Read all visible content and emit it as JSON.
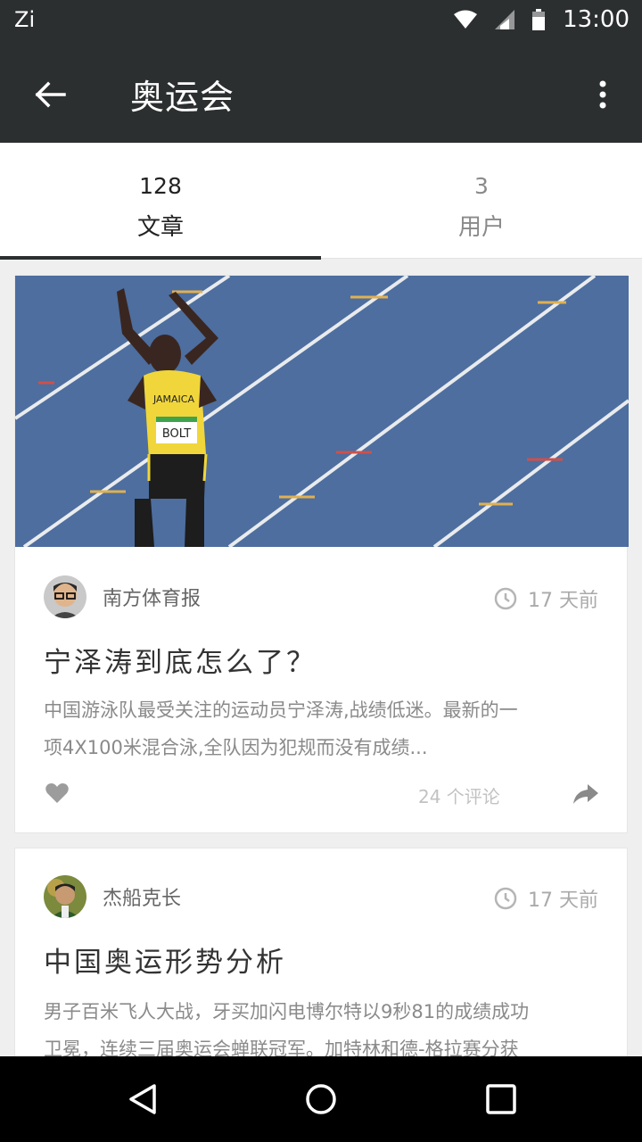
{
  "status_bar": {
    "left_text": "Zi",
    "time": "13:00"
  },
  "app_bar": {
    "title": "奥运会"
  },
  "tabs": [
    {
      "count": "128",
      "label": "文章"
    },
    {
      "count": "3",
      "label": "用户"
    }
  ],
  "posts": [
    {
      "author": "南方体育报",
      "time": "17 天前",
      "title": "宁泽涛到底怎么了？",
      "excerpt_line1": "中国游泳队最受关注的运动员宁泽涛,战绩低迷。最新的一",
      "excerpt_line2": "项4X100米混合泳,全队因为犯规而没有成绩...",
      "comments": "24 个评论",
      "hero_bib": "BOLT",
      "hero_jersey": "JAMAICA"
    },
    {
      "author": "杰船克长",
      "time": "17 天前",
      "title": "中国奥运形势分析",
      "excerpt_line1": "男子百米飞人大战，牙买加闪电博尔特以9秒81的成绩成功",
      "excerpt_line2": "卫冕，连续三届奥运会蝉联冠军。加特林和德-格拉赛分获"
    }
  ],
  "colors": {
    "bar": "#2c2f30",
    "accent": "#2c2f30",
    "track": "#4c6d9e"
  }
}
